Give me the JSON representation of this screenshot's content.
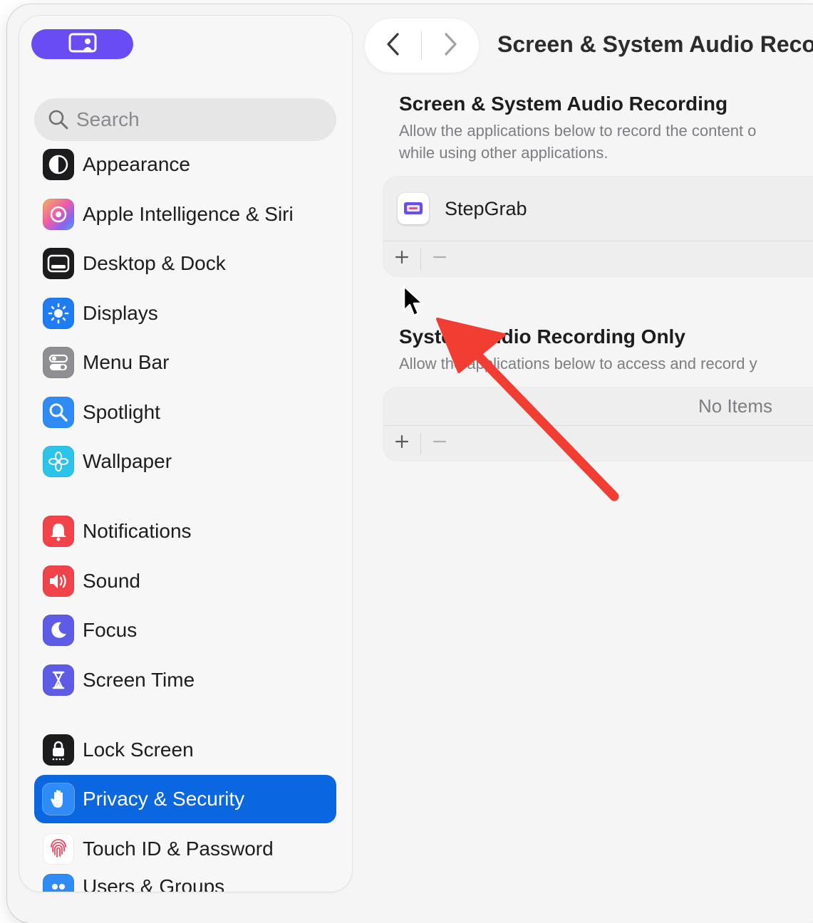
{
  "sidebar": {
    "search": {
      "placeholder": "Search"
    },
    "items": [
      {
        "label": "Appearance",
        "icon": "appearance-icon"
      },
      {
        "label": "Apple Intelligence & Siri",
        "icon": "siri-icon"
      },
      {
        "label": "Desktop & Dock",
        "icon": "dock-icon"
      },
      {
        "label": "Displays",
        "icon": "sun-icon"
      },
      {
        "label": "Menu Bar",
        "icon": "toggles-icon"
      },
      {
        "label": "Spotlight",
        "icon": "magnifier-icon"
      },
      {
        "label": "Wallpaper",
        "icon": "flower-icon"
      },
      {
        "label": "Notifications",
        "icon": "bell-icon"
      },
      {
        "label": "Sound",
        "icon": "speaker-icon"
      },
      {
        "label": "Focus",
        "icon": "moon-icon"
      },
      {
        "label": "Screen Time",
        "icon": "hourglass-icon"
      },
      {
        "label": "Lock Screen",
        "icon": "lock-icon"
      },
      {
        "label": "Privacy & Security",
        "icon": "hand-icon",
        "selected": true
      },
      {
        "label": "Touch ID & Password",
        "icon": "fingerprint-icon"
      },
      {
        "label": "Users & Groups",
        "icon": "users-icon"
      }
    ]
  },
  "header": {
    "title": "Screen & System Audio Reco",
    "back_icon": "chevron-left-icon",
    "forward_icon": "chevron-right-icon"
  },
  "main": {
    "section1": {
      "title": "Screen & System Audio Recording",
      "desc_line1": "Allow the applications below to record the content o",
      "desc_line2": "while using other applications.",
      "apps": [
        {
          "name": "StepGrab",
          "icon": "stepgrab-icon"
        }
      ]
    },
    "section2": {
      "title": "System Audio Recording Only",
      "desc": "Allow the applications below to access and record y",
      "empty_label": "No Items"
    },
    "add_label": "+",
    "remove_label": "−"
  },
  "colors": {
    "selection": "#0b67e0",
    "pill": "#6a4cf5",
    "annotation_arrow": "#f23d33"
  }
}
